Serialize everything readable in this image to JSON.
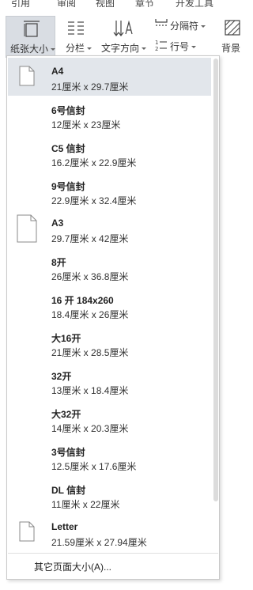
{
  "menubar": [
    "引用",
    "审阅",
    "视图",
    "章节",
    "开发工具"
  ],
  "ribbon": {
    "paper_size": "纸张大小",
    "columns": "分栏",
    "text_direction": "文字方向",
    "separator": "分隔符",
    "line_number": "行号",
    "background": "背景"
  },
  "paper_sizes": [
    {
      "name": "A4",
      "size": "21厘米 x 29.7厘米",
      "icon": "portrait-page-icon",
      "selected": true
    },
    {
      "name": "6号信封",
      "size": "12厘米 x 23厘米",
      "icon": "",
      "selected": false
    },
    {
      "name": "C5 信封",
      "size": "16.2厘米 x 22.9厘米",
      "icon": "",
      "selected": false
    },
    {
      "name": "9号信封",
      "size": "22.9厘米 x 32.4厘米",
      "icon": "",
      "selected": false
    },
    {
      "name": "A3",
      "size": "29.7厘米 x 42厘米",
      "icon": "large-page-icon",
      "selected": false
    },
    {
      "name": "8开",
      "size": "26厘米 x 36.8厘米",
      "icon": "",
      "selected": false
    },
    {
      "name": "16 开 184x260",
      "size": "18.4厘米 x 26厘米",
      "icon": "",
      "selected": false
    },
    {
      "name": "大16开",
      "size": "21厘米 x 28.5厘米",
      "icon": "",
      "selected": false
    },
    {
      "name": "32开",
      "size": "13厘米 x 18.4厘米",
      "icon": "",
      "selected": false
    },
    {
      "name": "大32开",
      "size": "14厘米 x 20.3厘米",
      "icon": "",
      "selected": false
    },
    {
      "name": "3号信封",
      "size": "12.5厘米 x 17.6厘米",
      "icon": "",
      "selected": false
    },
    {
      "name": "DL 信封",
      "size": "11厘米 x 22厘米",
      "icon": "",
      "selected": false
    },
    {
      "name": "Letter",
      "size": "21.59厘米 x 27.94厘米",
      "icon": "portrait-page-icon",
      "selected": false
    }
  ],
  "other_size": "其它页面大小(A)..."
}
